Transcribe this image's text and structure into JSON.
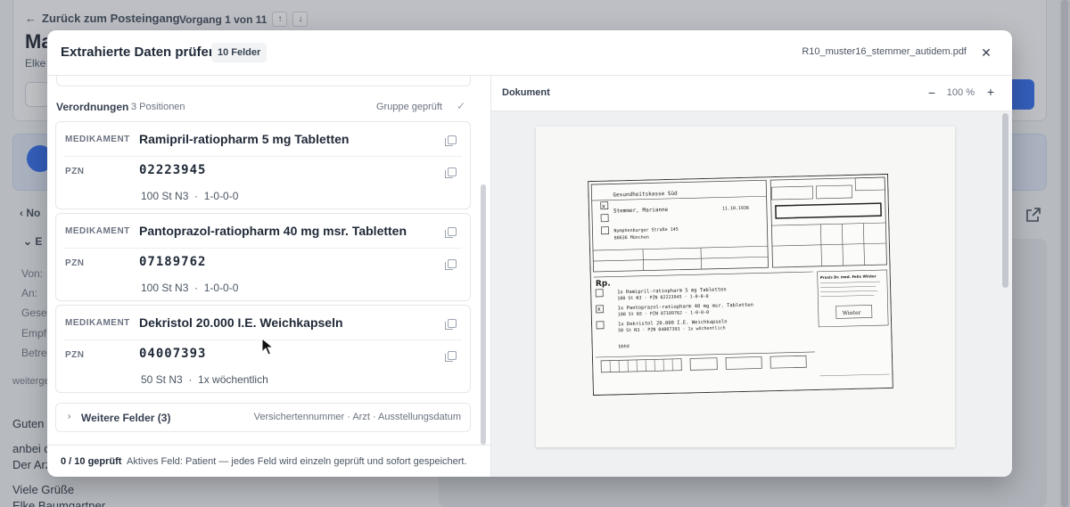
{
  "background": {
    "back_label": "Zurück zum Posteingang",
    "vorgang_label": "Vorgang 1 von 11",
    "title_partial": "Ma",
    "subtitle_partial": "Elke",
    "nav_partial": "No",
    "section_partial": "E",
    "fields": [
      "Von:",
      "An:",
      "Gese",
      "Empf",
      "Betre"
    ],
    "forwarded_partial": "weiterge",
    "mail_lines": [
      "Guten N",
      "anbei d",
      "Der Arzt",
      "Viele Grüße",
      "Elke Baumgartner"
    ]
  },
  "modal": {
    "title": "Extrahierte Daten prüfen",
    "badge": "10 Felder",
    "filename": "R10_muster16_stemmer_autidem.pdf",
    "group": {
      "title": "Verordnungen",
      "count": "3 Positionen",
      "status": "Gruppe geprüft"
    },
    "labels": {
      "medikament": "MEDIKAMENT",
      "pzn": "PZN"
    },
    "items": [
      {
        "medikament": "Ramipril-ratiopharm 5 mg Tabletten",
        "pzn": "02223945",
        "menge": "100 St N3",
        "dosierung": "1-0-0-0"
      },
      {
        "medikament": "Pantoprazol-ratiopharm 40 mg msr. Tabletten",
        "pzn": "07189762",
        "menge": "100 St N3",
        "dosierung": "1-0-0-0"
      },
      {
        "medikament": "Dekristol 20.000 I.E. Weichkapseln",
        "pzn": "04007393",
        "menge": "50 St N3",
        "dosierung": "1x wöchentlich"
      }
    ],
    "more": {
      "label": "Weitere Felder (3)",
      "fields": "Versichertennummer · Arzt · Ausstellungsdatum"
    },
    "footer": {
      "count": "0 / 10 geprüft",
      "hint": "Aktives Feld: Patient — jedes Feld wird einzeln geprüft und sofort gespeichert."
    },
    "document": {
      "title": "Dokument",
      "zoom": "100 %"
    }
  },
  "prescription_scan": {
    "kasse": "Gesundheitskasse Süd",
    "name": "Stemmer, Marianne",
    "dob": "11.10.1936",
    "street": "Nymphenburger Straße 145",
    "city": "80636 München",
    "lines": [
      "1x Ramipril-ratiopharm 5 mg Tabletten",
      "100 St N3  ·  PZN 02223945  ·  1-0-0-0",
      "1x Pantoprazol-ratiopharm 40 mg msr. Tabletten",
      "100 St N3  ·  PZN 07189762  ·  1-0-0-0",
      "1x Dekristol 20.000 I.E. Weichkapseln",
      "50 St N3  ·  PZN 04007393  ·  1x wöchentlich"
    ],
    "doctor": "Praxis Dr. med. Felix Winter",
    "signature": "Winter"
  }
}
